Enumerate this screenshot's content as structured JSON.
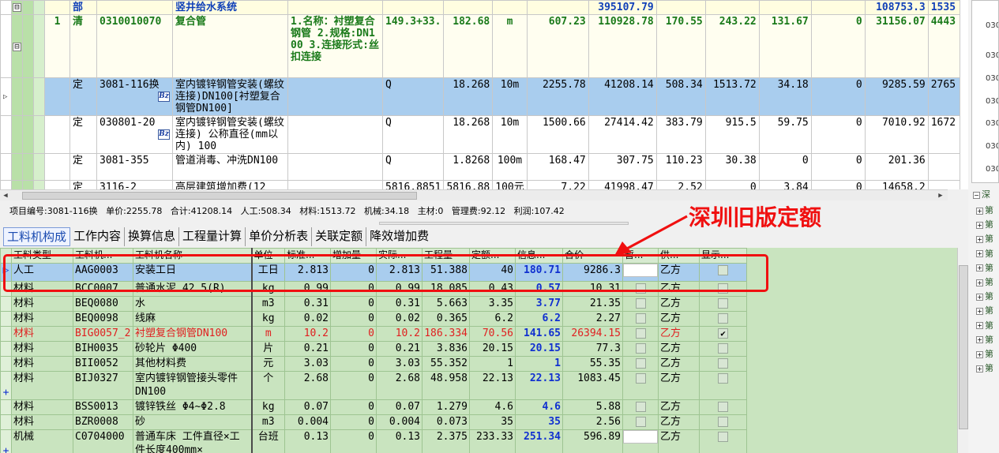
{
  "upper_grid": {
    "rows": [
      {
        "kind": "header",
        "expander": "⊟",
        "col_type": "部",
        "col_code": "",
        "col_name": "竖井给水系统",
        "col_feature": "",
        "col_qty_expr": "",
        "col_qty": "",
        "col_unit": "",
        "col_price": "",
        "col_total": "395107.79",
        "col_labor": "",
        "col_material": "",
        "col_machine": "",
        "col_main": "",
        "col_sum2": "108753.3",
        "col_extra": "1535"
      },
      {
        "kind": "item",
        "seq": "1",
        "expander": "⊟",
        "col_type": "清",
        "col_code": "0310010070",
        "col_name": "复合管",
        "col_feature": "1.名称：衬塑复合钢管 2.规格:DN100 3.连接形式:丝扣连接",
        "col_qty_expr": "149.3+33.",
        "col_qty": "182.68",
        "col_unit": "m",
        "col_price": "607.23",
        "col_total": "110928.78",
        "col_labor": "170.55",
        "col_material": "243.22",
        "col_machine": "131.67",
        "col_main": "0",
        "col_sum2": "31156.07",
        "col_extra": "4443"
      },
      {
        "kind": "sel",
        "ptr": "▷",
        "col_type": "定",
        "col_code": "3081-116换",
        "bz": "Bz",
        "col_name": "室内镀锌钢管安装(螺纹连接)DN100[衬塑复合钢管DN100]",
        "col_feature": "",
        "col_qty_expr": "Q",
        "col_qty": "18.268",
        "col_unit": "10m",
        "col_price": "2255.78",
        "col_total": "41208.14",
        "col_labor": "508.34",
        "col_material": "1513.72",
        "col_machine": "34.18",
        "col_main": "0",
        "col_sum2": "9285.59",
        "col_extra": "2765"
      },
      {
        "kind": "plain",
        "col_type": "定",
        "col_code": "030801-20",
        "bz": "Bz",
        "col_name": "室内镀锌钢管安装(螺纹连接) 公称直径(mm以内) 100",
        "col_feature": "",
        "col_qty_expr": "Q",
        "col_qty": "18.268",
        "col_unit": "10m",
        "col_price": "1500.66",
        "col_total": "27414.42",
        "col_labor": "383.79",
        "col_material": "915.5",
        "col_machine": "59.75",
        "col_main": "0",
        "col_sum2": "7010.92",
        "col_extra": "1672"
      },
      {
        "kind": "plain",
        "col_type": "定",
        "col_code": "3081-355",
        "col_name": "管道消毒、冲洗DN100",
        "col_feature": "",
        "col_qty_expr": "Q",
        "col_qty": "1.8268",
        "col_unit": "100m",
        "col_price": "168.47",
        "col_total": "307.75",
        "col_labor": "110.23",
        "col_material": "30.38",
        "col_machine": "0",
        "col_main": "0",
        "col_sum2": "201.36",
        "col_extra": ""
      },
      {
        "kind": "plain",
        "col_type": "定",
        "col_code": "3116-2",
        "bz": "Bz",
        "col_name": "高层建筑增加费(12",
        "col_feature": "",
        "col_qty_expr": "5816.8851",
        "col_qty": "5816.88",
        "col_unit": "100元",
        "col_price": "7.22",
        "col_total": "41998.47",
        "col_labor": "2.52",
        "col_material": "0",
        "col_machine": "3.84",
        "col_main": "0",
        "col_sum2": "14658.2",
        "col_extra": ""
      }
    ]
  },
  "infobar": {
    "code": "项目编号:3081-116换",
    "unit_price": "单价:2255.78",
    "total": "合计:41208.14",
    "labor": "人工:508.34",
    "material": "材料:1513.72",
    "machine": "机械:34.18",
    "main_mat": "主材:0",
    "mgmt": "管理费:92.12",
    "profit": "利润:107.42"
  },
  "tabs": [
    "工料机构成",
    "工作内容",
    "换算信息",
    "工程量计算",
    "单价分析表",
    "关联定额",
    "降效增加费"
  ],
  "lower_grid": {
    "headers": [
      "工料类型",
      "工料机...",
      "工料机名称",
      "单位",
      "标准...",
      "增加量",
      "实际...",
      "工程量",
      "定额...",
      "信息...",
      "合价",
      "暂...",
      "供...",
      "显示..."
    ],
    "rows": [
      {
        "style": "sel",
        "gut": "▷",
        "type": "人工",
        "code": "AAG0003",
        "name": "安装工日",
        "unit": "工日",
        "std": "2.813",
        "add": "0",
        "act": "2.813",
        "qty": "51.388",
        "quota": "40",
        "info": "180.71",
        "sum": "9286.3",
        "supply": "乙方",
        "tmp": "white",
        "show": ""
      },
      {
        "style": "",
        "gut": "",
        "type": "材料",
        "code": "BCC0007",
        "name": "普通水泥 42.5(R)",
        "unit": "kg",
        "std": "0.99",
        "add": "0",
        "act": "0.99",
        "qty": "18.085",
        "quota": "0.43",
        "info": "0.57",
        "sum": "10.31",
        "supply": "乙方",
        "tmp": "cb",
        "show": ""
      },
      {
        "style": "",
        "gut": "",
        "type": "材料",
        "code": "BEQ0080",
        "name": "水",
        "unit": "m3",
        "std": "0.31",
        "add": "0",
        "act": "0.31",
        "qty": "5.663",
        "quota": "3.35",
        "info": "3.77",
        "sum": "21.35",
        "supply": "乙方",
        "tmp": "cb",
        "show": ""
      },
      {
        "style": "",
        "gut": "",
        "type": "材料",
        "code": "BEQ0098",
        "name": "线麻",
        "unit": "kg",
        "std": "0.02",
        "add": "0",
        "act": "0.02",
        "qty": "0.365",
        "quota": "6.2",
        "info": "6.2",
        "sum": "2.27",
        "supply": "乙方",
        "tmp": "cb",
        "show": ""
      },
      {
        "style": "red",
        "gut": "",
        "type": "材料",
        "code": "BIG0057_2",
        "name": "衬塑复合钢管DN100",
        "unit": "m",
        "std": "10.2",
        "add": "0",
        "act": "10.2",
        "qty": "186.334",
        "quota": "70.56",
        "info": "141.65",
        "sum": "26394.15",
        "supply": "乙方",
        "tmp": "cb",
        "show": "✔"
      },
      {
        "style": "",
        "gut": "",
        "type": "材料",
        "code": "BIH0035",
        "name": "砂轮片 Φ400",
        "unit": "片",
        "std": "0.21",
        "add": "0",
        "act": "0.21",
        "qty": "3.836",
        "quota": "20.15",
        "info": "20.15",
        "sum": "77.3",
        "supply": "乙方",
        "tmp": "cb",
        "show": ""
      },
      {
        "style": "",
        "gut": "",
        "type": "材料",
        "code": "BII0052",
        "name": "其他材料费",
        "unit": "元",
        "std": "3.03",
        "add": "0",
        "act": "3.03",
        "qty": "55.352",
        "quota": "1",
        "info": "1",
        "sum": "55.35",
        "supply": "乙方",
        "tmp": "cb",
        "show": ""
      },
      {
        "style": "tall",
        "gut": "+",
        "type": "材料",
        "code": "BIJ0327",
        "name": "室内镀锌钢管接头零件 DN100",
        "unit": "个",
        "std": "2.68",
        "add": "0",
        "act": "2.68",
        "qty": "48.958",
        "quota": "22.13",
        "info": "22.13",
        "sum": "1083.45",
        "supply": "乙方",
        "tmp": "cb",
        "show": ""
      },
      {
        "style": "",
        "gut": "",
        "type": "材料",
        "code": "BSS0013",
        "name": "镀锌铁丝 Φ4~Φ2.8",
        "unit": "kg",
        "std": "0.07",
        "add": "0",
        "act": "0.07",
        "qty": "1.279",
        "quota": "4.6",
        "info": "4.6",
        "sum": "5.88",
        "supply": "乙方",
        "tmp": "cb",
        "show": ""
      },
      {
        "style": "",
        "gut": "",
        "type": "材料",
        "code": "BZR0008",
        "name": "砂",
        "unit": "m3",
        "std": "0.004",
        "add": "0",
        "act": "0.004",
        "qty": "0.073",
        "quota": "35",
        "info": "35",
        "sum": "2.56",
        "supply": "乙方",
        "tmp": "cb",
        "show": ""
      },
      {
        "style": "tall",
        "gut": "+",
        "type": "机械",
        "code": "C0704000",
        "name": "普通车床 工件直径×工件长度400mm×",
        "unit": "台班",
        "std": "0.13",
        "add": "0",
        "act": "0.13",
        "qty": "2.375",
        "quota": "233.33",
        "info": "251.34",
        "sum": "596.89",
        "supply": "乙方",
        "tmp": "white",
        "show": ""
      }
    ]
  },
  "right_panel": {
    "numbers": [
      "030",
      "030",
      "030",
      "030",
      "030",
      "030",
      "030"
    ],
    "tree_root": "深",
    "tree_nodes": [
      "第",
      "第",
      "第",
      "第",
      "第",
      "第",
      "第",
      "第",
      "第",
      "第",
      "第",
      "第"
    ]
  },
  "annotation": {
    "label": "深圳旧版定额",
    "color": "#f01010"
  }
}
